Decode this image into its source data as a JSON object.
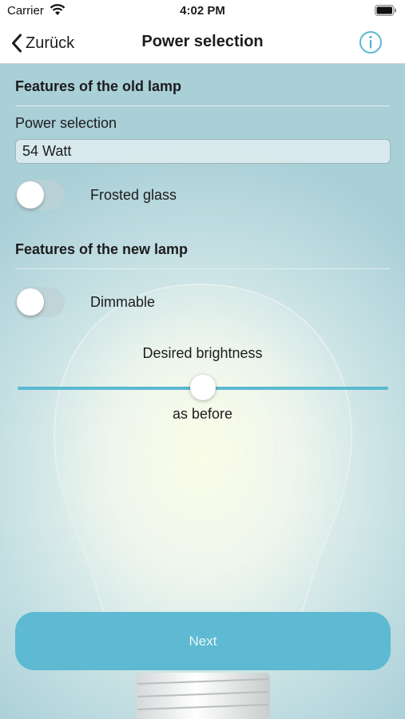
{
  "status_bar": {
    "carrier": "Carrier",
    "time": "4:02 PM"
  },
  "nav": {
    "back_label": "Zurück",
    "title": "Power selection",
    "info_icon": "info-circle-icon"
  },
  "old_lamp": {
    "header": "Features of the old lamp",
    "power_label": "Power selection",
    "power_value": "54 Watt",
    "frosted_label": "Frosted glass",
    "frosted_on": false
  },
  "new_lamp": {
    "header": "Features of the new lamp",
    "dimmable_label": "Dimmable",
    "dimmable_on": false,
    "brightness_title": "Desired brightness",
    "brightness_value": "as before",
    "brightness_fraction": 0.5
  },
  "next_label": "Next",
  "colors": {
    "accent": "#5dbad2",
    "slider": "#5ab9d0"
  }
}
